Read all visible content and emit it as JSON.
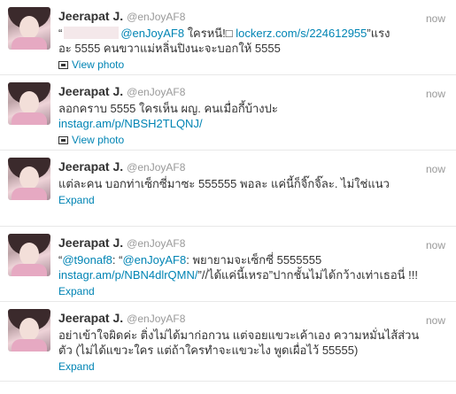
{
  "tweets": [
    {
      "name": "Jeerapat J.",
      "handle": "@enJoyAF8",
      "time": "now",
      "lines": [
        {
          "pre": "“",
          "blurred": true,
          "mention": "@enJoyAF8",
          "mid": " ใครหนี!□ ",
          "link": "lockerz.com/s/224612955",
          "post": "”แรง"
        },
        {
          "text": "อะ 5555 คนขวาแม่หลิ่นปิงนะจะบอกให้ 5555"
        }
      ],
      "action": "View photo",
      "action_icon": "photo-icon"
    },
    {
      "name": "Jeerapat J.",
      "handle": "@enJoyAF8",
      "time": "now",
      "line1": "ลอกคราบ 5555 ใครเห็น ผญ. คนเมื่อกี้บ้างปะ",
      "link": "instagr.am/p/NBSH2TLQNJ/",
      "action": "View photo",
      "action_icon": "photo-icon"
    },
    {
      "name": "Jeerapat J.",
      "handle": "@enJoyAF8",
      "time": "now",
      "line1": "แต่ละคน บอกท่าเซ็กซี่มาซะ 555555 พอละ แค่นี้ก็จิ๊กจิ๊ละ. ไม่ใช่แนว",
      "action": "Expand"
    },
    {
      "name": "Jeerapat J.",
      "handle": "@enJoyAF8",
      "time": "now",
      "pre": "“",
      "mention1": "@t9onaf8",
      "sep": ": “",
      "mention2": "@enJoyAF8",
      "mid": ": พยายามจะเซ็กซี่ 5555555",
      "link": "instagr.am/p/NBN4dlrQMN/",
      "post": "”//ได้แค่นี้เหรอ”ปากชั้นไม่ได้กว้างเท่าเธอนี่ !!!",
      "action": "Expand"
    },
    {
      "name": "Jeerapat J.",
      "handle": "@enJoyAF8",
      "time": "now",
      "line1": "อย่าเข้าใจผิดค่ะ ติ่งไม่ได้มาก่อกวน แต่จอยแขวะเค้าเอง ความหมั่นไส้ส่วน",
      "line2": "ตัว (ไม่ได้แขวะใคร แต่ถ้าใครทำจะแขวะไง พูดเผื่อไว้ 55555)",
      "action": "Expand"
    }
  ]
}
